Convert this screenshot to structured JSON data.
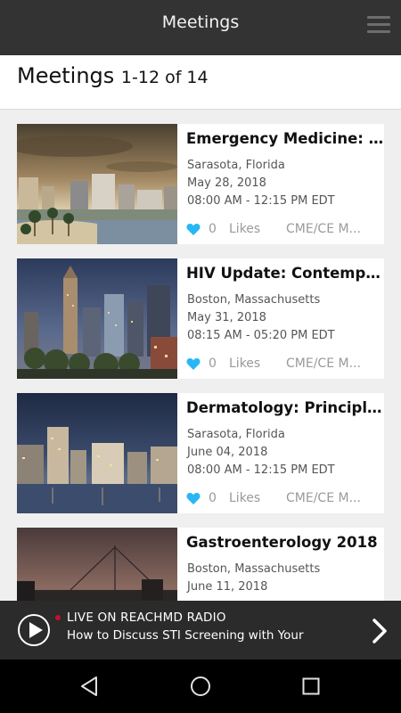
{
  "app": {
    "title": "Meetings",
    "menu_icon": "hamburger-menu-icon"
  },
  "header": {
    "title": "Meetings",
    "range": "1-12 of 14"
  },
  "meetings": [
    {
      "title": "Emergency Medicine: P...",
      "location": "Sarasota, Florida",
      "date": "May 28, 2018",
      "time": "08:00 AM - 12:15 PM EDT",
      "likes": "0",
      "likes_label": "Likes",
      "credit": "CME/CE M..."
    },
    {
      "title": "HIV Update: Contempo...",
      "location": "Boston, Massachusetts",
      "date": "May 31, 2018",
      "time": "08:15 AM - 05:20 PM EDT",
      "likes": "0",
      "likes_label": "Likes",
      "credit": "CME/CE M..."
    },
    {
      "title": "Dermatology: Principle...",
      "location": "Sarasota, Florida",
      "date": "June 04, 2018",
      "time": "08:00 AM - 12:15 PM EDT",
      "likes": "0",
      "likes_label": "Likes",
      "credit": "CME/CE M..."
    },
    {
      "title": "Gastroenterology 2018",
      "location": "Boston, Massachusetts",
      "date": "June 11, 2018"
    }
  ],
  "radio": {
    "live_label": "LIVE ON REACHMD RADIO",
    "now_playing": "How to Discuss STI Screening with Your"
  },
  "colors": {
    "heart": "#29b6f6",
    "live_dot": "#c8102e",
    "top_bar": "#333333"
  }
}
